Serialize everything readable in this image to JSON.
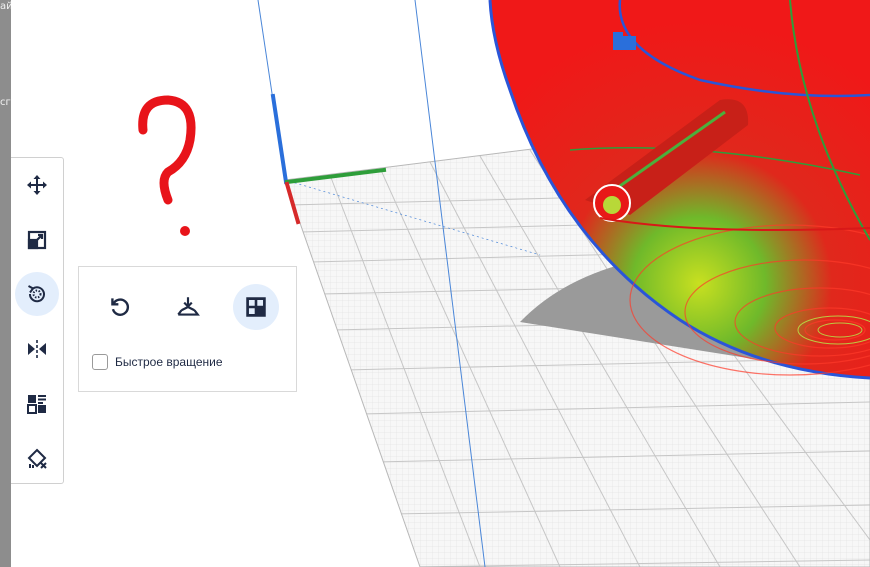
{
  "left_strip": {
    "text_fragments": [
      "ай",
      "сг"
    ]
  },
  "annotation": {
    "symbol": "?",
    "color": "#e8141a"
  },
  "toolbar": {
    "tools": [
      {
        "name": "move",
        "icon": "move-arrows-icon",
        "active": false
      },
      {
        "name": "scale",
        "icon": "scale-icon",
        "active": false
      },
      {
        "name": "rotate",
        "icon": "rotate-icon",
        "active": true
      },
      {
        "name": "mirror",
        "icon": "mirror-icon",
        "active": false
      },
      {
        "name": "per-model-settings",
        "icon": "per-model-settings-icon",
        "active": false
      },
      {
        "name": "support-blocker",
        "icon": "support-blocker-icon",
        "active": false
      }
    ]
  },
  "rotate_panel": {
    "buttons": [
      {
        "name": "reset-rotation",
        "icon": "reset-rotation-icon",
        "active": false
      },
      {
        "name": "lay-flat",
        "icon": "lay-flat-icon",
        "active": false
      },
      {
        "name": "select-face-to-align",
        "icon": "select-face-icon",
        "active": true
      }
    ],
    "fast_rotation": {
      "label": "Быстрое вращение",
      "checked": false
    }
  },
  "colors": {
    "accent": "#1f3a93",
    "active_bg": "#e3eefc",
    "model_red": "#ee1c1c",
    "axis_x": "#d62a2a",
    "axis_y": "#2e9e3a",
    "axis_z": "#2a6fdb"
  }
}
